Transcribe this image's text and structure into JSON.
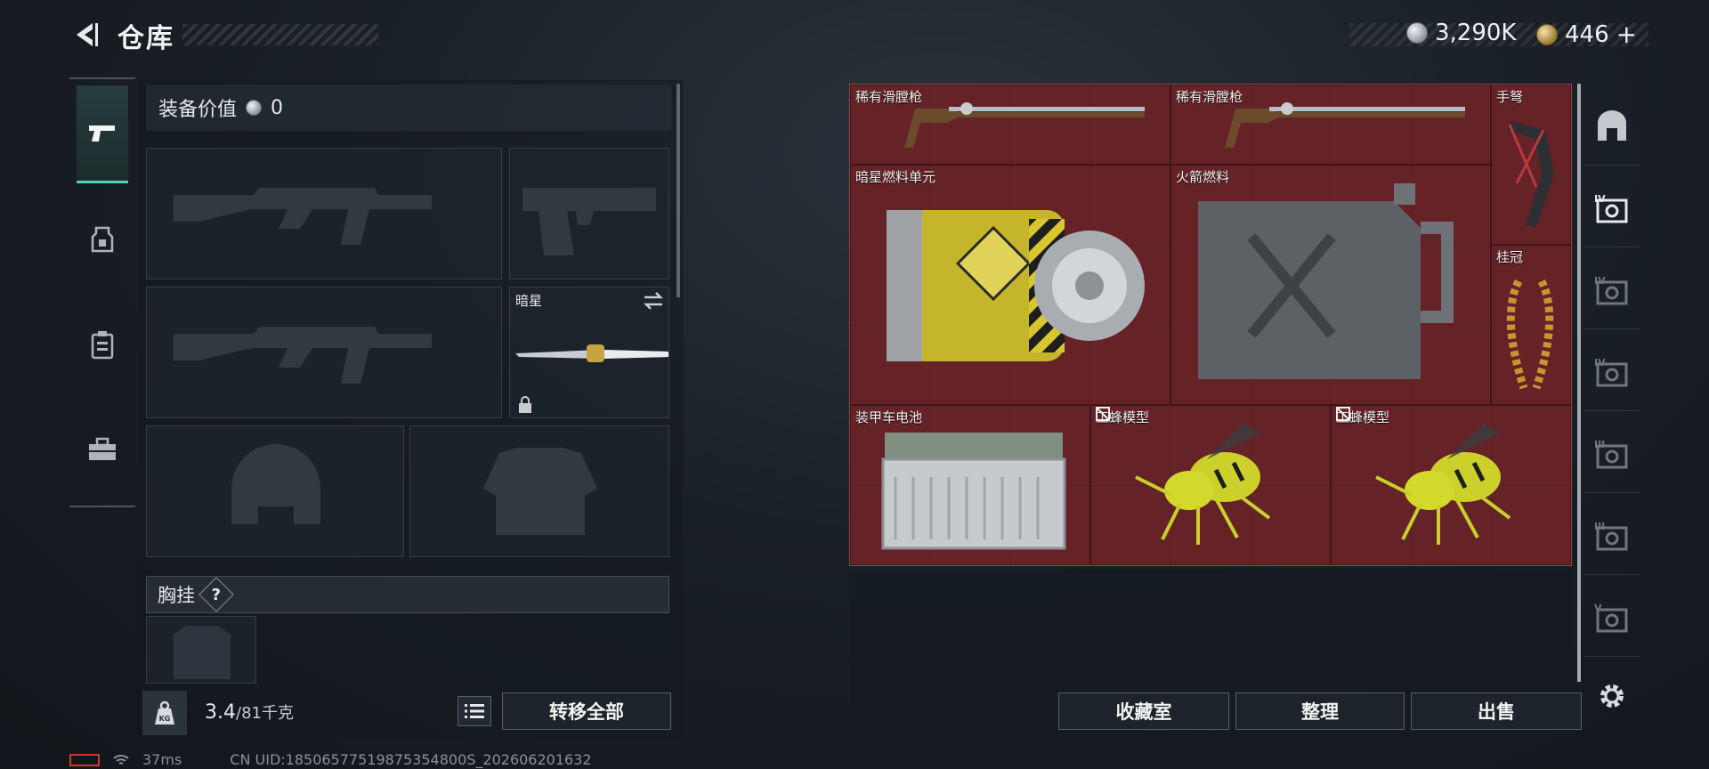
{
  "header": {
    "title": "仓库",
    "currency_silver": "3,290K",
    "currency_gold": "446",
    "add_label": "+"
  },
  "loadout": {
    "value_label": "装备价值",
    "value": "0",
    "melee_slot_label": "暗星",
    "chest_rig_label": "胸挂",
    "chest_rig_help": "?"
  },
  "footer_left": {
    "weight_current": "3.4",
    "weight_max": "/81千克",
    "weight_icon_text": "KG",
    "transfer_all": "转移全部"
  },
  "stash_items": [
    {
      "name": "稀有滑膛枪"
    },
    {
      "name": "稀有滑膛枪"
    },
    {
      "name": "手弩"
    },
    {
      "name": "暗星燃料单元"
    },
    {
      "name": "火箭燃料"
    },
    {
      "name": "桂冠"
    },
    {
      "name": "装甲车电池"
    },
    {
      "name": "工蜂模型"
    },
    {
      "name": "工蜂模型"
    }
  ],
  "side_tabs": [
    "warehouse-icon",
    "stash-IV-1",
    "stash-IV-2",
    "stash-IV-3",
    "stash-III-1",
    "stash-III-2",
    "stash-V"
  ],
  "side_tab_labels": [
    "IV",
    "IV",
    "IV",
    "III",
    "III",
    "V"
  ],
  "footer_right": {
    "collection": "收藏室",
    "organize": "整理",
    "sell": "出售"
  },
  "status": {
    "ping": "37ms",
    "uid": "CN UID:18506577519875354800S_202606201632"
  },
  "colors": {
    "accent": "#4fd2b1",
    "item_bg": "#6a2429",
    "battery": "#d4342a"
  }
}
